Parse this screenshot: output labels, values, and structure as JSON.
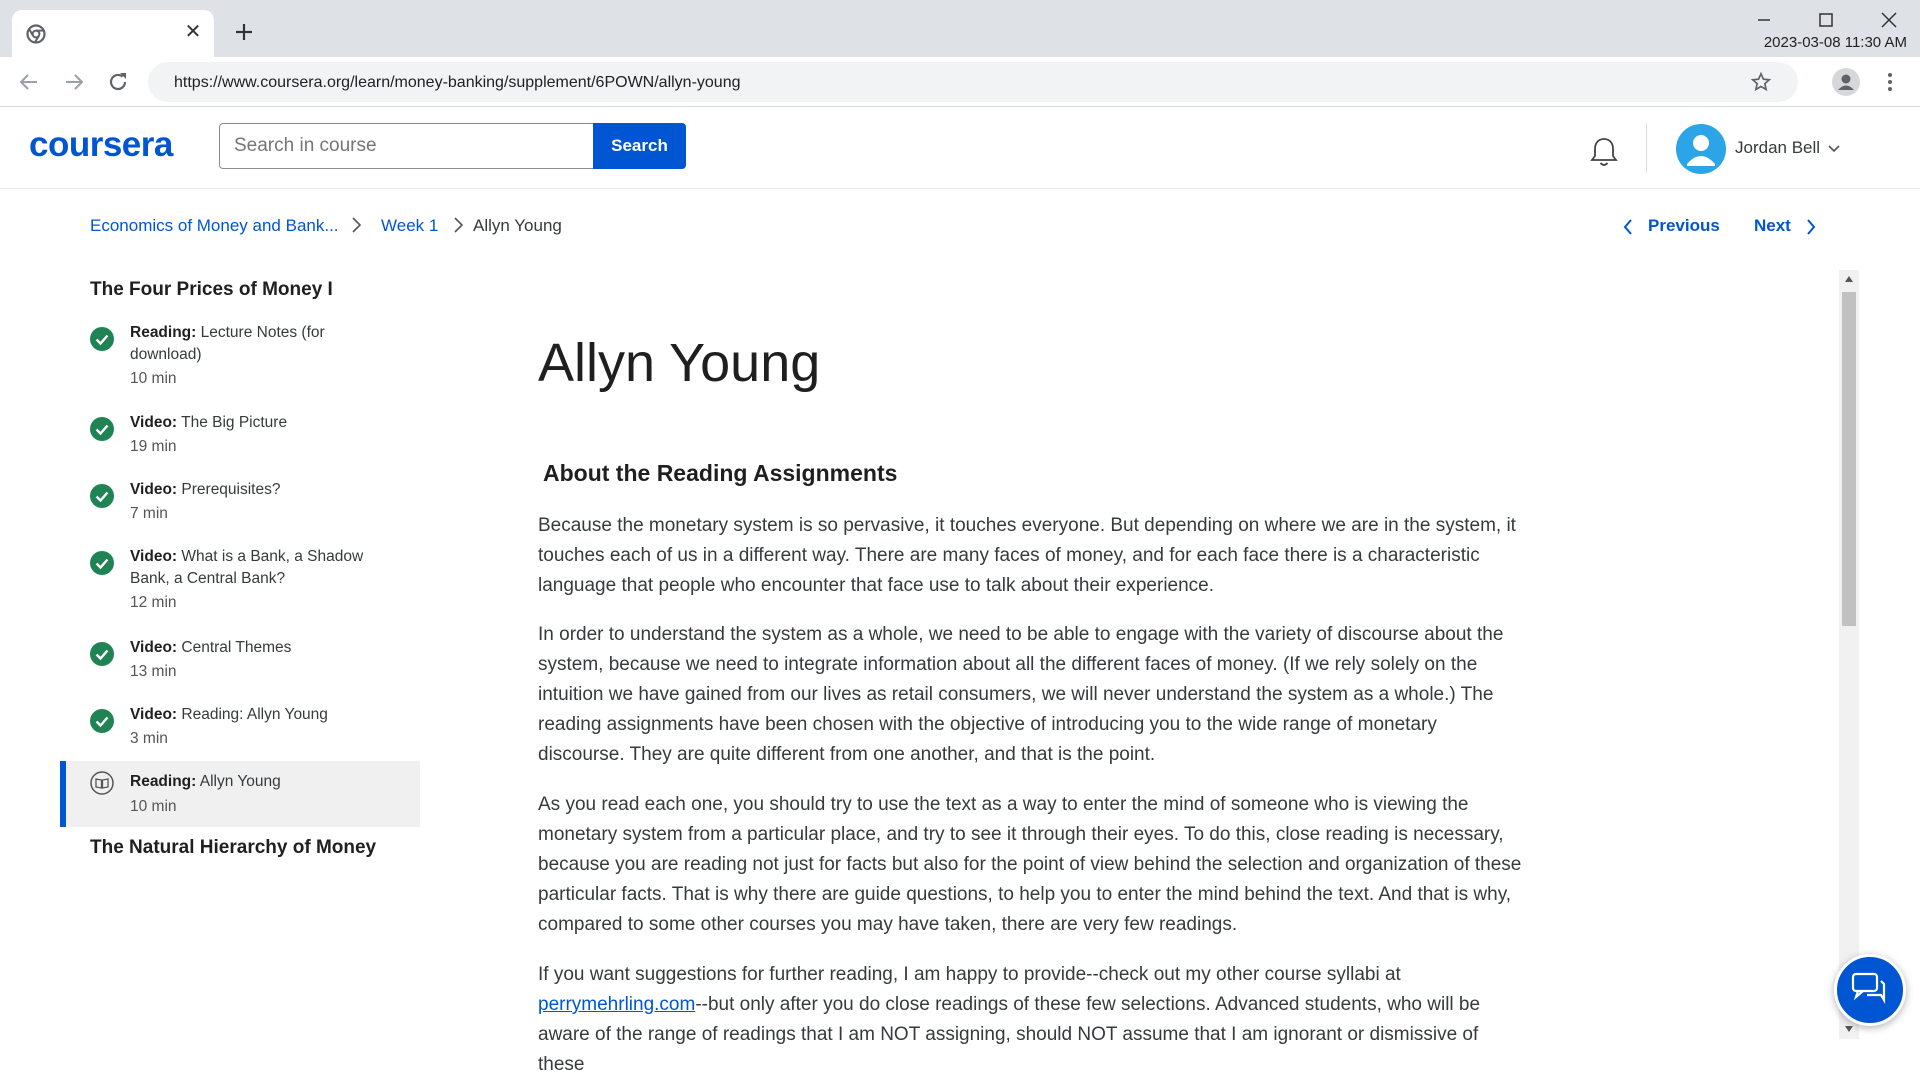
{
  "browser": {
    "tab_close_glyph": "✕",
    "url": "https://www.coursera.org/learn/money-banking/supplement/6POWN/allyn-young",
    "datetime": "2023-03-08 11:30 AM"
  },
  "header": {
    "logo": "coursera",
    "search_placeholder": "Search in course",
    "search_button": "Search",
    "user_name": "Jordan Bell"
  },
  "breadcrumb": {
    "course": "Economics of Money and Bank...",
    "week": "Week 1",
    "current": "Allyn Young"
  },
  "nav": {
    "previous": "Previous",
    "next": "Next"
  },
  "sidebar": {
    "section1_title": "The Four Prices of Money I",
    "items": [
      {
        "type": "Reading:",
        "title": "Lecture Notes (for download)",
        "duration": "10 min"
      },
      {
        "type": "Video:",
        "title": "The Big Picture",
        "duration": "19 min"
      },
      {
        "type": "Video:",
        "title": "Prerequisites?",
        "duration": "7 min"
      },
      {
        "type": "Video:",
        "title": "What is a Bank, a Shadow Bank, a Central Bank?",
        "duration": "12 min"
      },
      {
        "type": "Video:",
        "title": "Central Themes",
        "duration": "13 min"
      },
      {
        "type": "Video:",
        "title": "Reading: Allyn Young",
        "duration": "3 min"
      },
      {
        "type": "Reading:",
        "title": "Allyn Young",
        "duration": "10 min"
      }
    ],
    "section2_title": "The Natural Hierarchy of Money"
  },
  "main": {
    "title": "Allyn Young",
    "section_heading": "About the Reading Assignments",
    "paragraphs": [
      "Because the monetary system is so pervasive, it touches everyone.  But depending on where we are in the system, it touches each of us in a different way.  There are many faces of money, and for each face there is a characteristic language that people who encounter that face use to talk about their experience.",
      "In order to understand the system as a whole, we need to be able to engage with the variety of discourse about the system, because we need to integrate information about all the different faces of money.  (If we rely solely on the intuition we have gained from our lives as retail consumers, we will never understand the system as a whole.)  The reading assignments have been chosen with the objective of introducing you to the wide range of monetary discourse.  They are quite different from one another, and that is the point.",
      "As you read each one, you should try to use the text as a way to enter the mind of someone who is viewing the monetary system from a particular place, and try to see it through their eyes.  To do this, close reading is necessary, because you are reading not just for facts but also for the point of view behind the selection and organization of these particular facts.  That is why there are guide questions, to help you to enter the mind behind the text.  And that is why, compared to some other courses you may have taken, there are very few readings."
    ],
    "para4_before": "If you want suggestions for further reading, I am happy to provide--check out my other course syllabi at ",
    "para4_link": "perrymehrling.com",
    "para4_after": "--but only after you do close readings of these few selections.  Advanced students, who will be aware of the range of readings that I am NOT assigning, should NOT assume that I am ignorant or dismissive of these"
  },
  "colors": {
    "brand": "#0056d2",
    "complete": "#1f8354"
  }
}
